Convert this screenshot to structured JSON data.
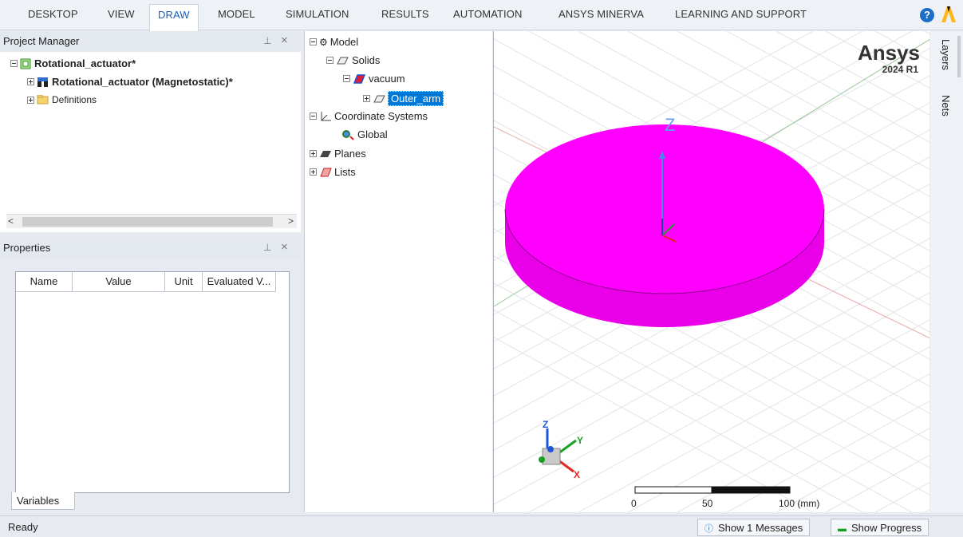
{
  "ribbon": {
    "tabs": [
      "DESKTOP",
      "VIEW",
      "DRAW",
      "MODEL",
      "SIMULATION",
      "RESULTS",
      "AUTOMATION",
      "ANSYS MINERVA",
      "LEARNING AND SUPPORT"
    ],
    "active_tab": "DRAW",
    "help_icon": "question-icon",
    "logo_icon": "ansys-logo-icon"
  },
  "project_manager": {
    "title": "Project Manager",
    "project": "Rotational_actuator*",
    "design": "Rotational_actuator (Magnetostatic)*",
    "definitions": "Definitions"
  },
  "properties": {
    "title": "Properties",
    "columns": [
      "Name",
      "Value",
      "Unit",
      "Evaluated V..."
    ],
    "variables_tab": "Variables"
  },
  "model_tree": {
    "model": "Model",
    "solids": "Solids",
    "material": "vacuum",
    "object": "Outer_arm",
    "coord_systems": "Coordinate Systems",
    "global": "Global",
    "planes": "Planes",
    "lists": "Lists"
  },
  "viewport": {
    "brand": "Ansys",
    "version": "2024 R1",
    "axis_z_label": "Z",
    "triad": {
      "z": "Z",
      "y": "Y",
      "x": "X"
    },
    "scale": {
      "labels": [
        "0",
        "50",
        "100 (mm)"
      ]
    },
    "object_color": "#ff00ff"
  },
  "right_sidebar": {
    "tabs": [
      "Layers",
      "Nets"
    ]
  },
  "statusbar": {
    "status": "Ready",
    "messages_button": "Show 1 Messages",
    "progress_button": "Show Progress"
  },
  "colors": {
    "accent": "#1a5fb4",
    "selection": "#0078d7"
  }
}
